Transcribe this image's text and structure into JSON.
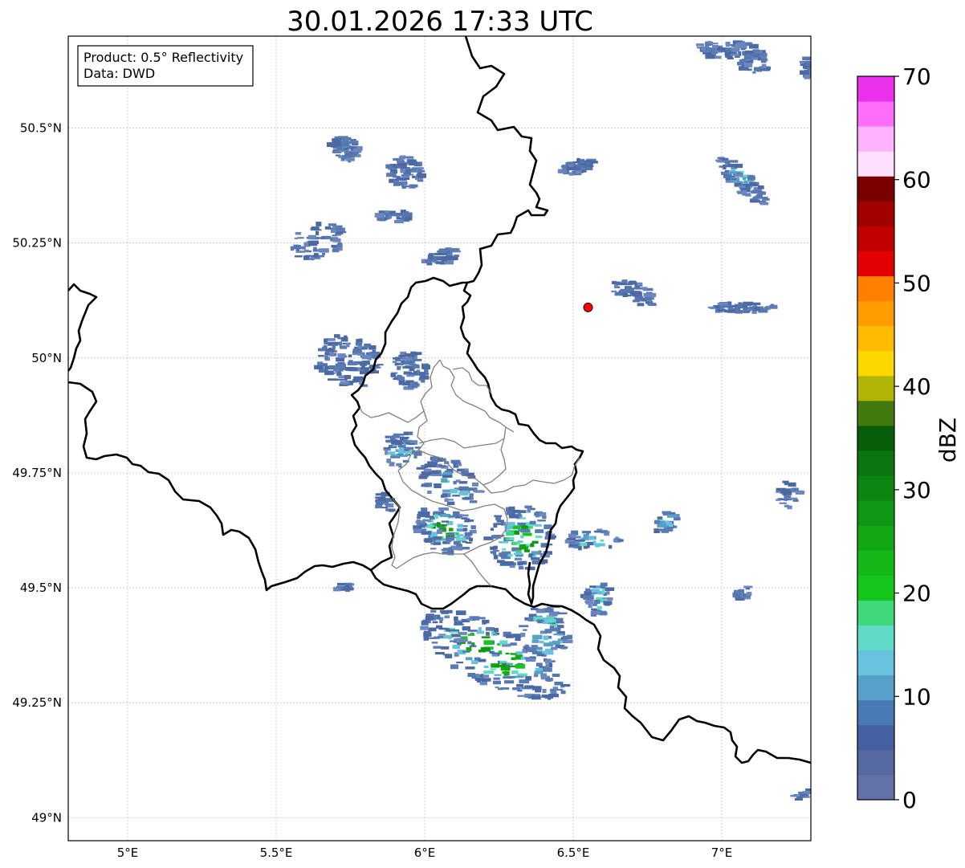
{
  "title": "30.01.2026 17:33 UTC",
  "info_box": {
    "line1": "Product: 0.5° Reflectivity",
    "line2": "Data: DWD"
  },
  "map": {
    "lon_range": [
      4.8,
      7.3
    ],
    "lat_range": [
      48.95,
      50.7
    ],
    "lon_ticks": [
      {
        "value": 5.0,
        "label": "5°E"
      },
      {
        "value": 5.5,
        "label": "5.5°E"
      },
      {
        "value": 6.0,
        "label": "6°E"
      },
      {
        "value": 6.5,
        "label": "6.5°E"
      },
      {
        "value": 7.0,
        "label": "7°E"
      }
    ],
    "lat_ticks": [
      {
        "value": 50.5,
        "label": "50.5°N"
      },
      {
        "value": 50.25,
        "label": "50.25°N"
      },
      {
        "value": 50.0,
        "label": "50°N"
      },
      {
        "value": 49.75,
        "label": "49.75°N"
      },
      {
        "value": 49.5,
        "label": "49.5°N"
      },
      {
        "value": 49.25,
        "label": "49.25°N"
      },
      {
        "value": 49.0,
        "label": "49°N"
      }
    ],
    "radar_site": {
      "lon": 6.55,
      "lat": 50.11,
      "color": "#ff0000"
    }
  },
  "colorbar": {
    "label": "dBZ",
    "min": 0,
    "max": 70,
    "tick_labels": [
      "0",
      "10",
      "20",
      "30",
      "40",
      "50",
      "60",
      "70"
    ],
    "colors": [
      "#6272a6",
      "#5569a0",
      "#4560a2",
      "#4a7ab5",
      "#57a0c9",
      "#66c2dd",
      "#60d9c7",
      "#3fd877",
      "#14c61a",
      "#14b817",
      "#12a712",
      "#0f9612",
      "#0c8611",
      "#0b760f",
      "#095e0c",
      "#427a0f",
      "#b1b407",
      "#ffd800",
      "#ffbb00",
      "#ff9d00",
      "#ff7f00",
      "#e30000",
      "#c10000",
      "#a00000",
      "#7a0000",
      "#ffdfff",
      "#ffb3ff",
      "#ff6ef9",
      "#eb30eb"
    ]
  },
  "legend": {
    "label": "dBZ"
  }
}
